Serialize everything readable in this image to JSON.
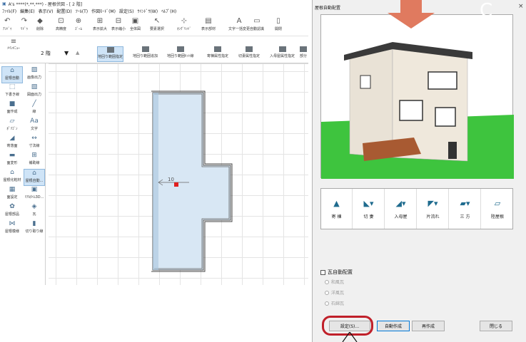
{
  "window": {
    "title": "A's ****(*,**,***) - 屋根伏図 - [ 2 階]",
    "menu": [
      "ﾌｧｲﾙ(F)",
      "編集(E)",
      "表示(V)",
      "配置(D)",
      "ﾂｰﾙ(T)",
      "作図ﾓｰﾄﾞ(M)",
      "設定(S)",
      "ｳｲﾝﾄﾞｳ(W)",
      "ﾍﾙﾌﾟ(H)"
    ]
  },
  "toolbar1": [
    "ｱﾝﾄﾞｩ",
    "ﾘﾄﾞｩ",
    "削除",
    "高精度",
    "ｽﾞｰﾑ",
    "表示拡大",
    "表示縮小",
    "全体図",
    "要素選択",
    "ｵﾝｸﾞﾘｯﾄﾞ",
    "表示部材",
    "文字一括変更",
    "自動認識",
    "開閉"
  ],
  "toolbar2": {
    "floor": "2 階",
    "menu_label": "ﾒｲﾝﾒﾆｭｰ",
    "items": [
      "地回り範囲指定",
      "地回り範囲追加",
      "地回り範囲ｾｯﾄ線",
      "寄棟属性指定",
      "切妻属性指定",
      "入母屋属性指定",
      "部分"
    ]
  },
  "left_panel": [
    "屋根自動",
    "画像出力",
    "下書き線",
    "図面出力",
    "面作成",
    "線",
    "ﾎﾟﾘｺﾞﾝ",
    "文字",
    "寄落面",
    "寸法線",
    "面変形",
    "補助線",
    "屋根化粧材",
    "屋根自動...",
    "面設定",
    "ﾘｱﾙﾀｲﾑ3D...",
    "屋根部品",
    "瓦",
    "屋根模様",
    "切り取り線"
  ],
  "canvas": {
    "dimension_label": "10"
  },
  "dialog": {
    "title": "屋根自動配置",
    "close": "×",
    "roof_types": [
      "寄 棟",
      "切 妻",
      "入母屋",
      "片流れ",
      "三 方",
      "陸屋根"
    ],
    "tile_auto_label": "瓦自動配置",
    "tile_options": [
      "和風瓦",
      "洋風瓦",
      "石綿瓦"
    ],
    "buttons": {
      "settings": "設定(S)...",
      "auto_create": "自動作成",
      "recreate": "再作成",
      "close": "閉じる"
    }
  },
  "colors": {
    "accent": "#e07a5f",
    "highlight": "#c0202a",
    "roof_plan": "#d8e7f4",
    "roof_bar_icon": "#1f6b8e"
  }
}
